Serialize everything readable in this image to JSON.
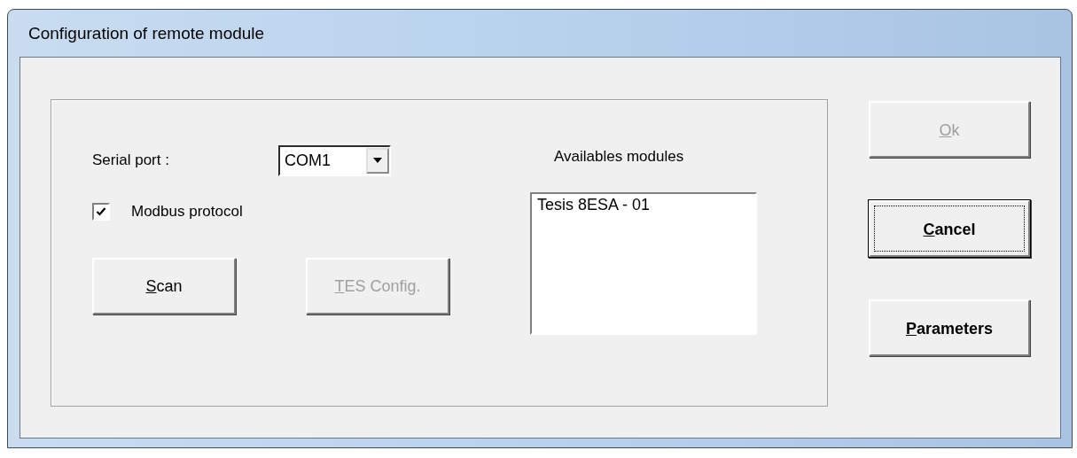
{
  "window": {
    "title": "Configuration of remote module"
  },
  "serial_port": {
    "label": "Serial port :",
    "value": "COM1"
  },
  "modbus": {
    "label": "Modbus protocol",
    "checked": true
  },
  "panel_buttons": [
    {
      "label": "Scan",
      "disabled": false
    },
    {
      "label": "TES Config.",
      "disabled": true
    }
  ],
  "modules": {
    "label": "Availables modules",
    "items": [
      {
        "label": "Tesis 8ESA - 01",
        "selected": false
      }
    ]
  },
  "side_buttons": [
    {
      "label": "Ok",
      "disabled": true,
      "focused": false
    },
    {
      "label": "Cancel",
      "disabled": false,
      "focused": true
    },
    {
      "label": "Parameters",
      "disabled": false,
      "focused": false
    }
  ]
}
